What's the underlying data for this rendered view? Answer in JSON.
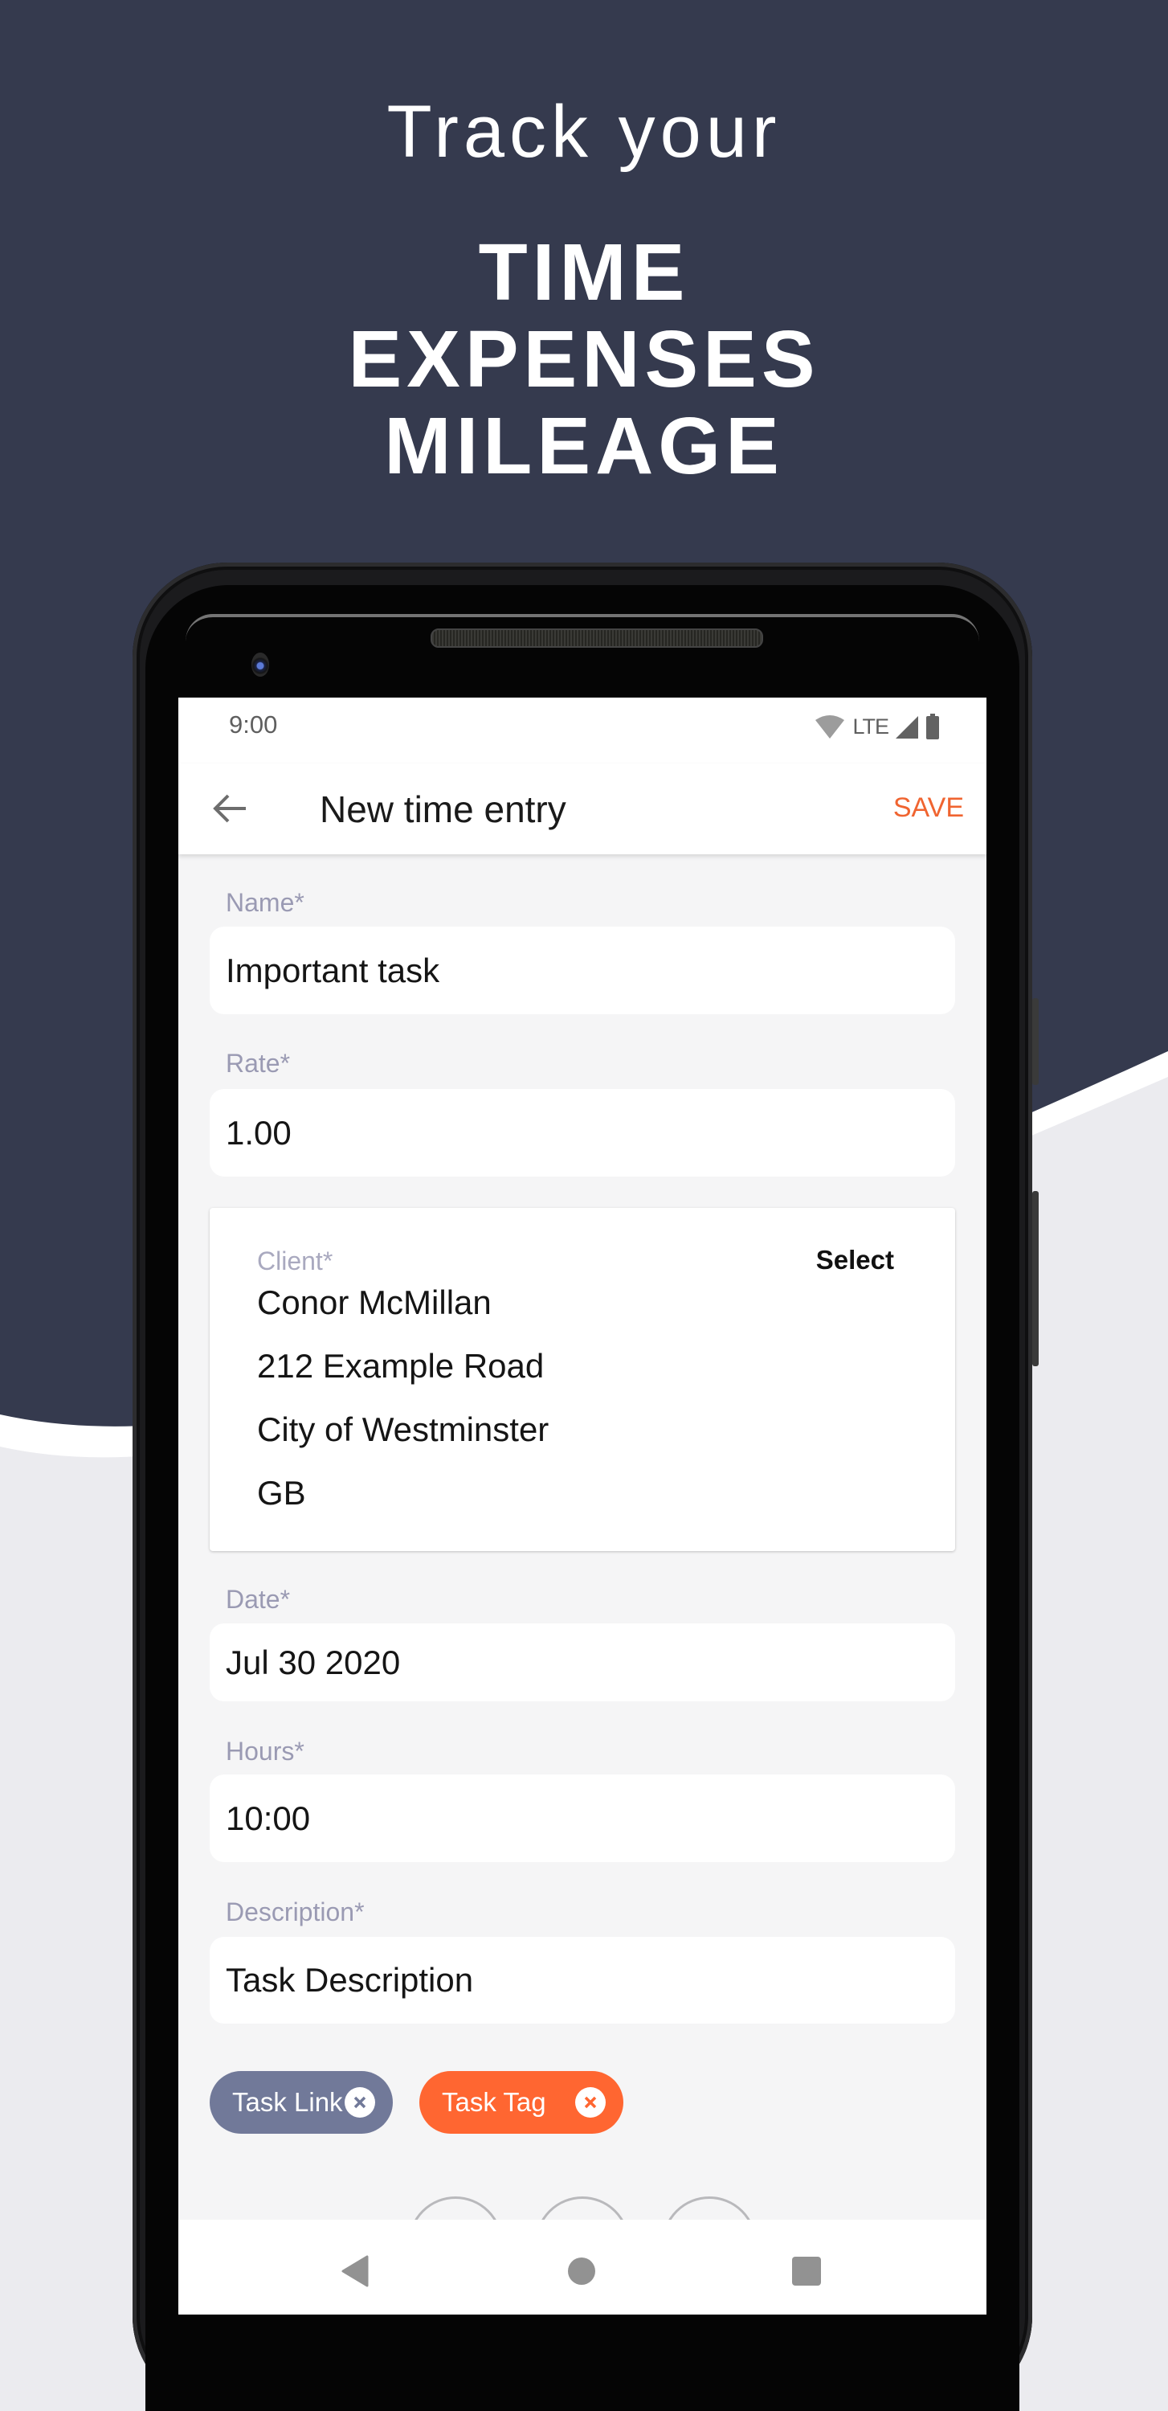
{
  "colors": {
    "background_dark": "#353a4e",
    "background_light": "#ebebef",
    "accent_orange": "#ff6631",
    "save_orange": "#f06430",
    "chip_slate": "#717999",
    "label_gray": "#9a9ab3"
  },
  "headline": {
    "intro": "Track your",
    "items": [
      "TIME",
      "EXPENSES",
      "MILEAGE"
    ]
  },
  "status_bar": {
    "time": "9:00",
    "network": "LTE",
    "icons": [
      "wifi-icon",
      "signal-icon",
      "battery-icon"
    ]
  },
  "app_bar": {
    "back_icon": "arrow-left-icon",
    "title": "New time entry",
    "save_label": "SAVE"
  },
  "form": {
    "name": {
      "label": "Name*",
      "value": "Important task"
    },
    "rate": {
      "label": "Rate*",
      "value": "1.00"
    },
    "client": {
      "label": "Client*",
      "select_label": "Select",
      "lines": [
        "Conor McMillan",
        "212 Example Road",
        "City of Westminster",
        "GB"
      ]
    },
    "date": {
      "label": "Date*",
      "value": "Jul 30 2020"
    },
    "hours": {
      "label": "Hours*",
      "value": "10:00"
    },
    "description": {
      "label": "Description*",
      "value": "Task Description"
    }
  },
  "chips": [
    {
      "label": "Task Link",
      "close_icon": "close-circle-icon"
    },
    {
      "label": "Task Tag",
      "close_icon": "close-circle-icon"
    }
  ],
  "nav_bar": {
    "buttons": [
      "back-triangle-icon",
      "home-circle-icon",
      "recents-square-icon"
    ]
  }
}
